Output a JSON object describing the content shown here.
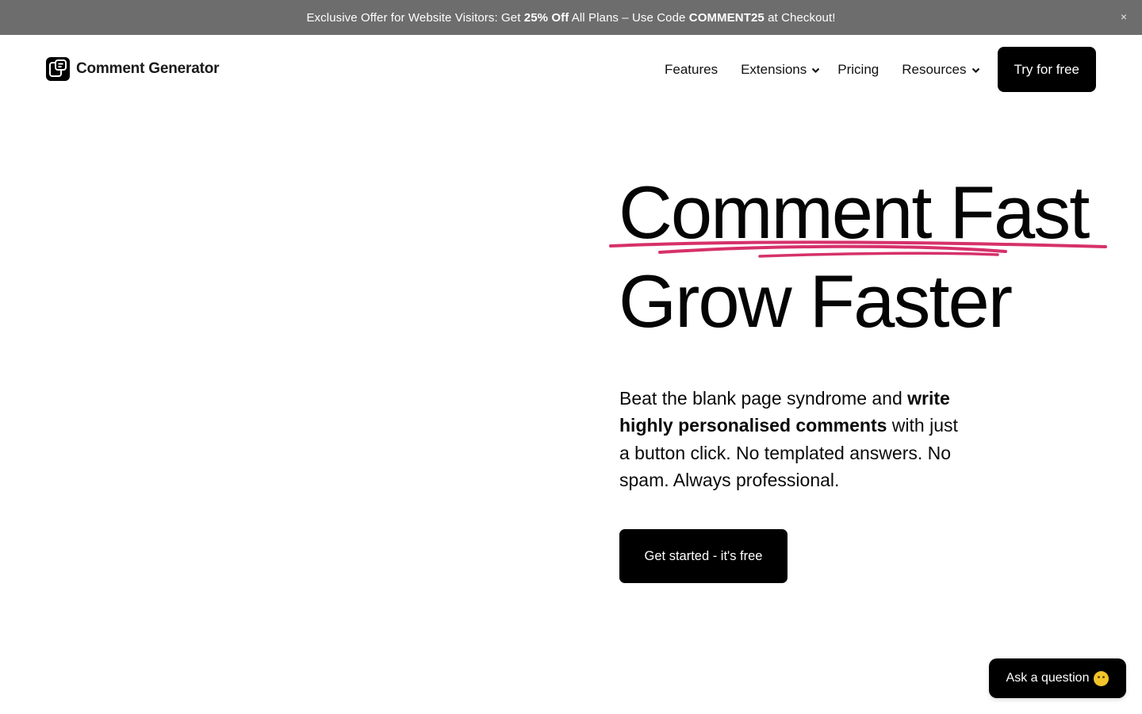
{
  "promo": {
    "prefix": "Exclusive Offer for Website Visitors: Get ",
    "discount": "25% Off",
    "middle": " All Plans – Use Code ",
    "code": "COMMENT25",
    "suffix": " at Checkout!",
    "close_icon": "×",
    "background": "#6d6d6d"
  },
  "header": {
    "logo_text": "Comment Generator",
    "nav": {
      "features": "Features",
      "extensions": "Extensions",
      "pricing": "Pricing",
      "resources": "Resources"
    },
    "cta": "Try for free"
  },
  "hero": {
    "title_line1": "Comment Fast",
    "title_line2": "Grow Faster",
    "text_part1": "Beat the blank page syndrome and ",
    "text_bold": "write highly personalised comments",
    "text_part2": " with just a button click. No templated answers. No spam. Always professional.",
    "cta": "Get started - it's free",
    "underline_color": "#d6316a"
  },
  "widget": {
    "ask_label": "Ask a question",
    "ask_icon": "thinking-face-icon"
  }
}
